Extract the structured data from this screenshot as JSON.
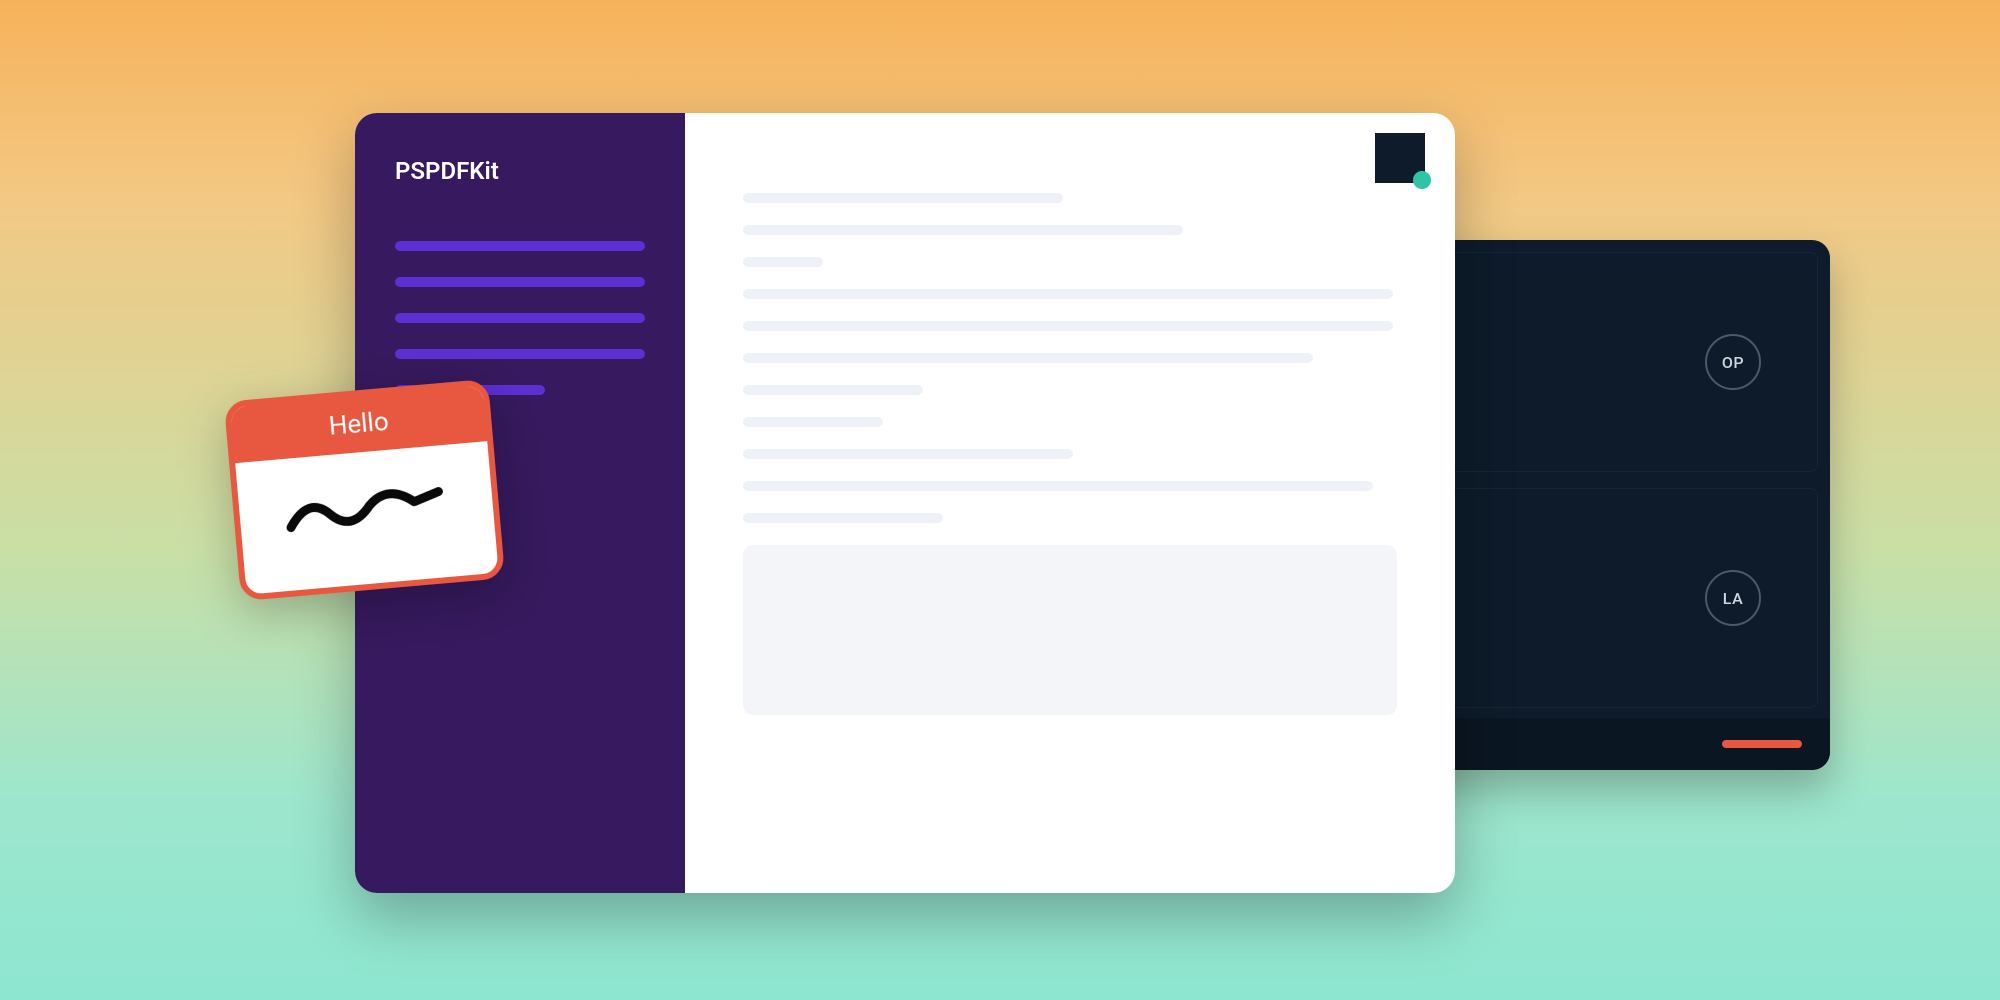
{
  "sidebar": {
    "title": "PSPDFKit",
    "nav_line_widths": [
      250,
      250,
      250,
      250,
      150
    ]
  },
  "content": {
    "line_widths": [
      320,
      440,
      80,
      650,
      650,
      570,
      180,
      140,
      330,
      630,
      200
    ]
  },
  "video": {
    "participants": [
      {
        "initials": "OP"
      },
      {
        "initials": "LA"
      }
    ]
  },
  "name_tag": {
    "label": "Hello"
  },
  "colors": {
    "sidebar_bg": "#36195e",
    "sidebar_accent": "#5c2fd2",
    "accent_orange": "#e8573f",
    "accent_teal": "#2ec4a4",
    "dark_panel": "#0d1b2a"
  }
}
